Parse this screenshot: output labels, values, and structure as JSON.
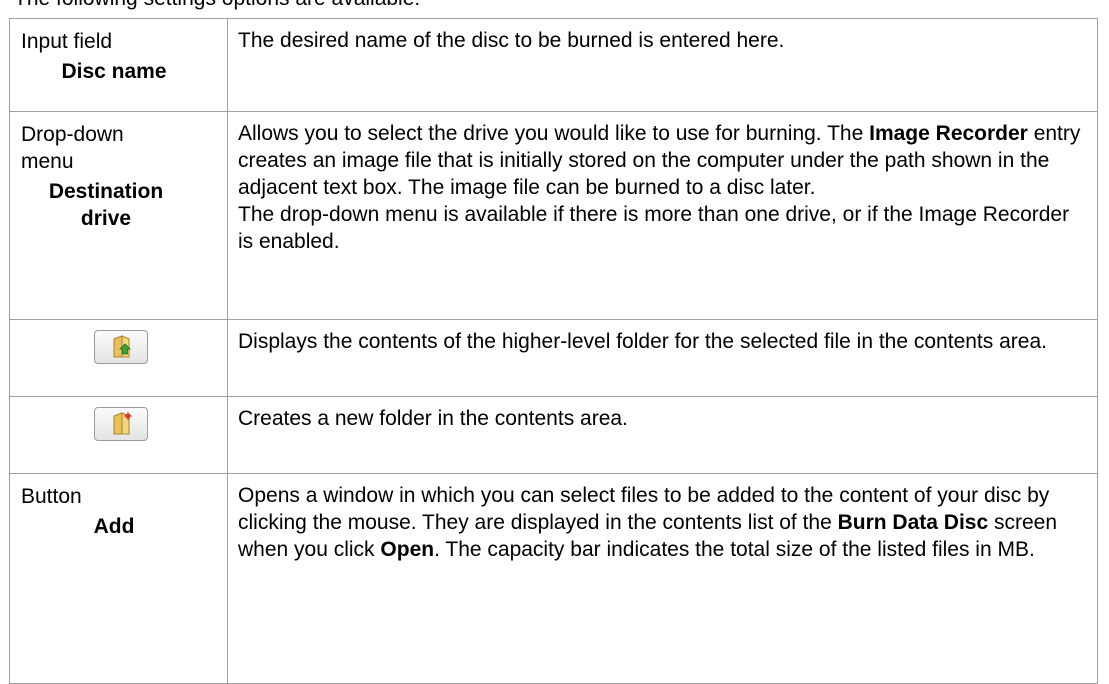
{
  "top_cut_text": "The following settings options are available:",
  "rows": [
    {
      "type": "Input field",
      "name": "Disc name",
      "desc": "The desired name of the disc to be burned is entered here."
    },
    {
      "type": "Drop-down menu",
      "name": "Destination drive",
      "desc_p1_a": "Allows you to select the drive you would like to use for burning. The ",
      "desc_p1_bold": "Image Recorder",
      "desc_p1_b": " entry creates an image file that is initially stored on the computer under the path shown in the adjacent text box. The image file can be burned to a disc later.",
      "desc_p2": "The drop-down menu is available if there is more than one drive, or if the Image Recorder is enabled."
    },
    {
      "icon": "folder-up-icon",
      "desc": "Displays the contents of the higher-level folder for the selected file in the contents area."
    },
    {
      "icon": "new-folder-icon",
      "desc": "Creates a new folder in the contents area."
    },
    {
      "type": "Button",
      "name": "Add",
      "desc_a": "Opens a window in which you can select files to be added to the content of your disc by clicking the mouse. They are displayed in the contents list of the ",
      "desc_bold1": "Burn Data Disc",
      "desc_b": " screen when you click ",
      "desc_bold2": "Open",
      "desc_c": ". The capacity bar indicates the total size of the listed files in MB."
    }
  ]
}
